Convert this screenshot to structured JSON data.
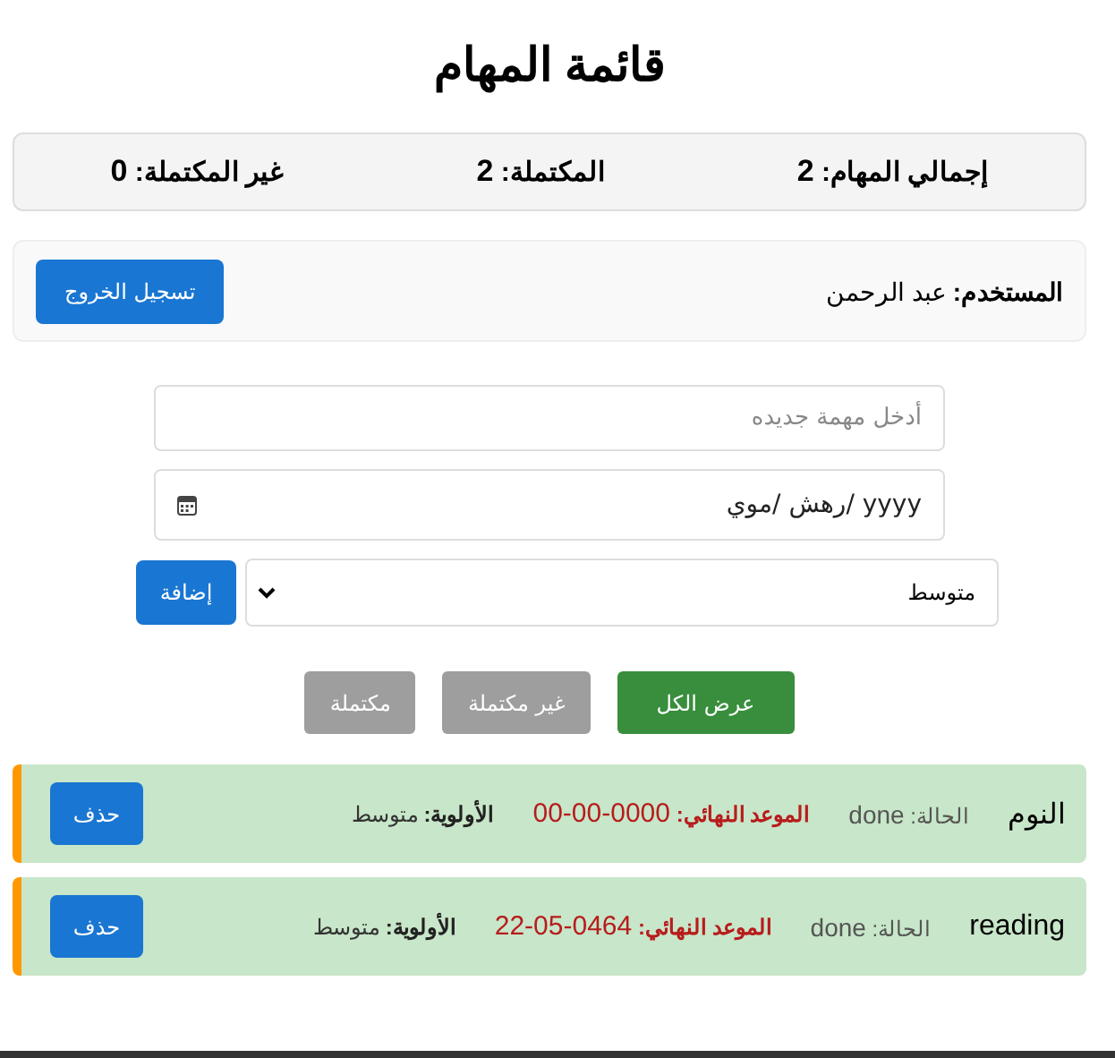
{
  "title": "قائمة المهام",
  "stats": [
    {
      "label": "إجمالي المهام:",
      "value": "2"
    },
    {
      "label": "المكتملة:",
      "value": "2"
    },
    {
      "label": "غير المكتملة:",
      "value": "0"
    }
  ],
  "user": {
    "label": "المستخدم:",
    "name": "عبد الرحمن",
    "logout": "تسجيل الخروج"
  },
  "form": {
    "task_placeholder": "أدخل مهمة جديده",
    "date_placeholder": "yyyy /رهش /موي",
    "priority": "متوسط",
    "add": "إضافة"
  },
  "filters": [
    {
      "label": "عرض الكل",
      "selected": true
    },
    {
      "label": "غير مكتملة",
      "selected": false
    },
    {
      "label": "مكتملة",
      "selected": false
    }
  ],
  "tasks": [
    {
      "title": "النوم",
      "status_label": "الحالة:",
      "status": "done",
      "completed": true,
      "deadline_label": "الموعد النهائي:",
      "deadline": "00-00-0000",
      "priority_label": "الأولوية:",
      "priority": "متوسط",
      "delete": "حذف"
    },
    {
      "title": "reading",
      "status_label": "الحالة:",
      "status": "done",
      "completed": true,
      "deadline_label": "الموعد النهائي:",
      "deadline": "22-05-0464",
      "priority_label": "الأولوية:",
      "priority": "متوسط",
      "delete": "حذف"
    }
  ]
}
